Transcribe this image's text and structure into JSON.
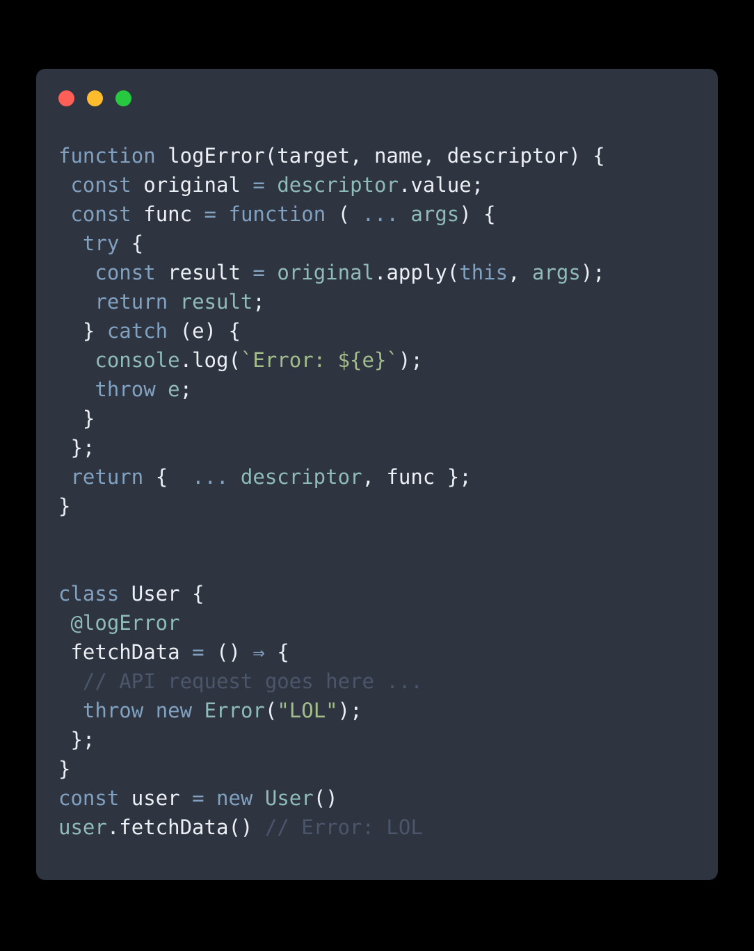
{
  "window": {
    "background_color": "#000000",
    "card_color": "#2E3440",
    "traffic_lights": [
      {
        "name": "close",
        "color": "#FF5F56"
      },
      {
        "name": "minimize",
        "color": "#FFBD2E"
      },
      {
        "name": "maximize",
        "color": "#27C93F"
      }
    ]
  },
  "theme": {
    "keyword": "#81A1C1",
    "identifier": "#8FBCBB",
    "plain": "#ECEFF4",
    "string": "#A3BE8C",
    "comment": "#4C566A"
  },
  "code": {
    "language": "javascript",
    "lines": [
      "function logError(target, name, descriptor) {",
      " const original = descriptor.value;",
      " const func = function ( ... args) {",
      "  try {",
      "   const result = original.apply(this, args);",
      "   return result;",
      "  } catch (e) {",
      "   console.log(`Error: ${e}`);",
      "   throw e;",
      "  }",
      " };",
      " return {  ... descriptor, func };",
      "}",
      "",
      "",
      "class User {",
      " @logError",
      " fetchData = () ⇒ {",
      "  // API request goes here ...",
      "  throw new Error(\"LOL\");",
      " };",
      "}",
      "const user = new User()",
      "user.fetchData() // Error: LOL"
    ],
    "plain_text": "function logError(target, name, descriptor) {\n const original = descriptor.value;\n const func = function ( ... args) {\n  try {\n   const result = original.apply(this, args);\n   return result;\n  } catch (e) {\n   console.log(`Error: ${e}`);\n   throw e;\n  }\n };\n return {  ... descriptor, func };\n}\n\n\nclass User {\n @logError\n fetchData = () ⇒ {\n  // API request goes here ...\n  throw new Error(\"LOL\");\n };\n}\nconst user = new User()\nuser.fetchData() // Error: LOL"
  }
}
